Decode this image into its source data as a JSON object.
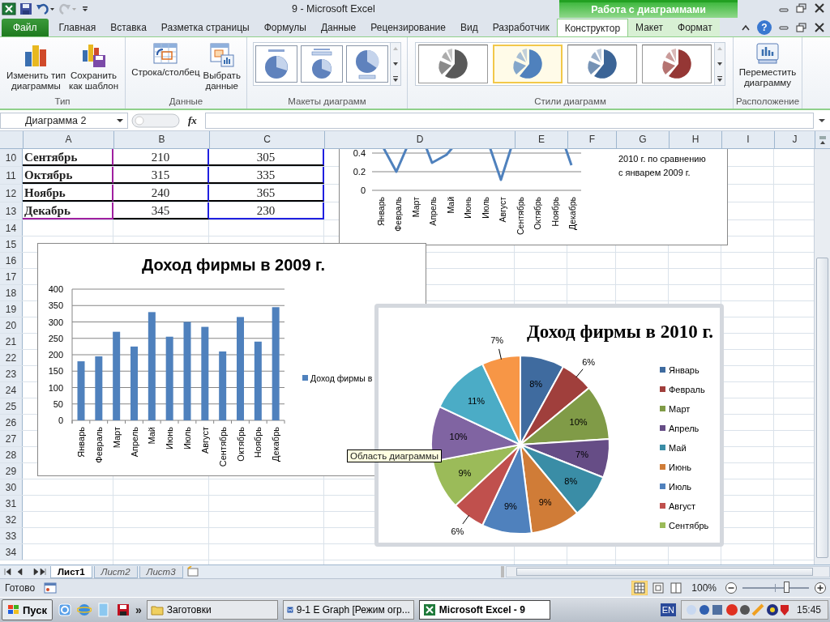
{
  "title_bar": {
    "title": "9  -  Microsoft Excel",
    "context_title": "Работа с диаграммами"
  },
  "tabs": [
    {
      "label": "Файл",
      "kind": "file",
      "selected": false
    },
    {
      "label": "Главная",
      "kind": "normal",
      "selected": false
    },
    {
      "label": "Вставка",
      "kind": "normal",
      "selected": false
    },
    {
      "label": "Разметка страницы",
      "kind": "normal",
      "selected": false
    },
    {
      "label": "Формулы",
      "kind": "normal",
      "selected": false
    },
    {
      "label": "Данные",
      "kind": "normal",
      "selected": false
    },
    {
      "label": "Рецензирование",
      "kind": "normal",
      "selected": false
    },
    {
      "label": "Вид",
      "kind": "normal",
      "selected": false
    },
    {
      "label": "Разработчик",
      "kind": "normal",
      "selected": false
    },
    {
      "label": "Конструктор",
      "kind": "context",
      "selected": true
    },
    {
      "label": "Макет",
      "kind": "context",
      "selected": false
    },
    {
      "label": "Формат",
      "kind": "context",
      "selected": false
    }
  ],
  "help_label": "?",
  "ribbon": {
    "type_group": {
      "label": "Тип",
      "buttons": [
        {
          "lines": [
            "Изменить тип",
            "диаграммы"
          ]
        },
        {
          "lines": [
            "Сохранить",
            "как шаблон"
          ]
        }
      ]
    },
    "data_group": {
      "label": "Данные",
      "buttons": [
        {
          "lines": [
            "Строка/столбец"
          ]
        },
        {
          "lines": [
            "Выбрать",
            "данные"
          ]
        }
      ]
    },
    "layouts_group": {
      "label": "Макеты диаграмм"
    },
    "styles_group": {
      "label": "Стили диаграмм",
      "styles": [
        {
          "selected": false
        },
        {
          "selected": true
        },
        {
          "selected": false
        },
        {
          "selected": false
        }
      ]
    },
    "location_group": {
      "label": "Расположение",
      "buttons": [
        {
          "lines": [
            "Переместить",
            "диаграмму"
          ]
        }
      ]
    }
  },
  "formula_bar": {
    "name_box": "Диаграмма 2",
    "function_label": "fx"
  },
  "sheet": {
    "columns": [
      "A",
      "B",
      "C",
      "D",
      "E",
      "F",
      "G",
      "H",
      "I",
      "J"
    ],
    "rows": [
      {
        "number": "10",
        "cells": [
          "Сентябрь",
          "210",
          "305"
        ]
      },
      {
        "number": "11",
        "cells": [
          "Октябрь",
          "315",
          "335"
        ]
      },
      {
        "number": "12",
        "cells": [
          "Ноябрь",
          "240",
          "365"
        ]
      },
      {
        "number": "13",
        "cells": [
          "Декабрь",
          "345",
          "230"
        ]
      },
      {
        "number": "14"
      },
      {
        "number": "15"
      },
      {
        "number": "16"
      },
      {
        "number": "17"
      },
      {
        "number": "18"
      },
      {
        "number": "19"
      },
      {
        "number": "20"
      },
      {
        "number": "21"
      },
      {
        "number": "22"
      },
      {
        "number": "23"
      },
      {
        "number": "24"
      },
      {
        "number": "25"
      },
      {
        "number": "26"
      },
      {
        "number": "27"
      },
      {
        "number": "28"
      },
      {
        "number": "29"
      },
      {
        "number": "30"
      },
      {
        "number": "31"
      },
      {
        "number": "32"
      },
      {
        "number": "33"
      },
      {
        "number": "34"
      }
    ]
  },
  "line_chart": {
    "y_tick_labels": [
      "0.4",
      "0.2",
      "0"
    ],
    "category_labels": [
      "Январь",
      "Февраль",
      "Март",
      "Апрель",
      "Май",
      "Июнь",
      "Июль",
      "Август",
      "Сентябрь",
      "Октябрь",
      "Ноябрь",
      "Декабрь"
    ],
    "note_lines": [
      "2010 г. по сравнению",
      "с январем 2009 г."
    ]
  },
  "bar_chart": {
    "chart_data": {
      "type": "bar",
      "title": "Доход фирмы в 2009 г.",
      "categories": [
        "Январь",
        "Февраль",
        "Март",
        "Апрель",
        "Май",
        "Июнь",
        "Июль",
        "Август",
        "Сентябрь",
        "Октябрь",
        "Ноябрь",
        "Декабрь"
      ],
      "series": [
        {
          "name": "Доход фирмы в",
          "color": "#4f81bd",
          "values": [
            180,
            195,
            270,
            225,
            330,
            255,
            300,
            285,
            210,
            315,
            240,
            345
          ]
        }
      ],
      "ylim": [
        0,
        400
      ],
      "yticks": [
        0,
        50,
        100,
        150,
        200,
        250,
        300,
        350,
        400
      ],
      "grid": true,
      "legend": "right"
    }
  },
  "pie_chart": {
    "chart_data": {
      "type": "pie",
      "title": "Доход фирмы в 2010 г.",
      "values": [
        8,
        6,
        10,
        7,
        8,
        9,
        9,
        6,
        9,
        10,
        11,
        7
      ],
      "colors": [
        "#3f6b9f",
        "#a03f3c",
        "#809b47",
        "#664d86",
        "#3a8da6",
        "#d07c37",
        "#4f81bd",
        "#c0504d",
        "#9bbb59",
        "#8064a2",
        "#4bacc6",
        "#f79646"
      ],
      "value_labels": [
        "8%",
        "6%",
        "10%",
        "7%",
        "8%",
        "9%",
        "9%",
        "6%",
        "9%",
        "10%",
        "11%",
        "7%"
      ],
      "data_labels": true
    },
    "legend": [
      {
        "label": "Январь",
        "color": "#3f6b9f"
      },
      {
        "label": "Февраль",
        "color": "#a03f3c"
      },
      {
        "label": "Март",
        "color": "#809b47"
      },
      {
        "label": "Апрель",
        "color": "#664d86"
      },
      {
        "label": "Май",
        "color": "#3a8da6"
      },
      {
        "label": "Июнь",
        "color": "#d07c37"
      },
      {
        "label": "Июль",
        "color": "#4f81bd"
      },
      {
        "label": "Август",
        "color": "#c0504d"
      },
      {
        "label": "Сентябрь",
        "color": "#9bbb59"
      }
    ]
  },
  "tooltip": "Область диаграммы",
  "sheet_tabs": [
    {
      "label": "Лист1",
      "selected": true
    },
    {
      "label": "Лист2",
      "selected": false
    },
    {
      "label": "Лист3",
      "selected": false
    }
  ],
  "status_bar": {
    "status": "Готово",
    "zoom": "100%",
    "zoom_slider": {
      "level": 0.66
    }
  },
  "taskbar": {
    "start": "Пуск",
    "more": "»",
    "items": [
      {
        "label": "Заготовки",
        "kind": "folder",
        "selected": false
      },
      {
        "label": "9-1 E Graph [Режим огр...",
        "kind": "word",
        "selected": false
      },
      {
        "label": "Microsoft Excel - 9",
        "kind": "excel",
        "selected": true
      }
    ],
    "language": "EN",
    "clock": "15:45"
  }
}
